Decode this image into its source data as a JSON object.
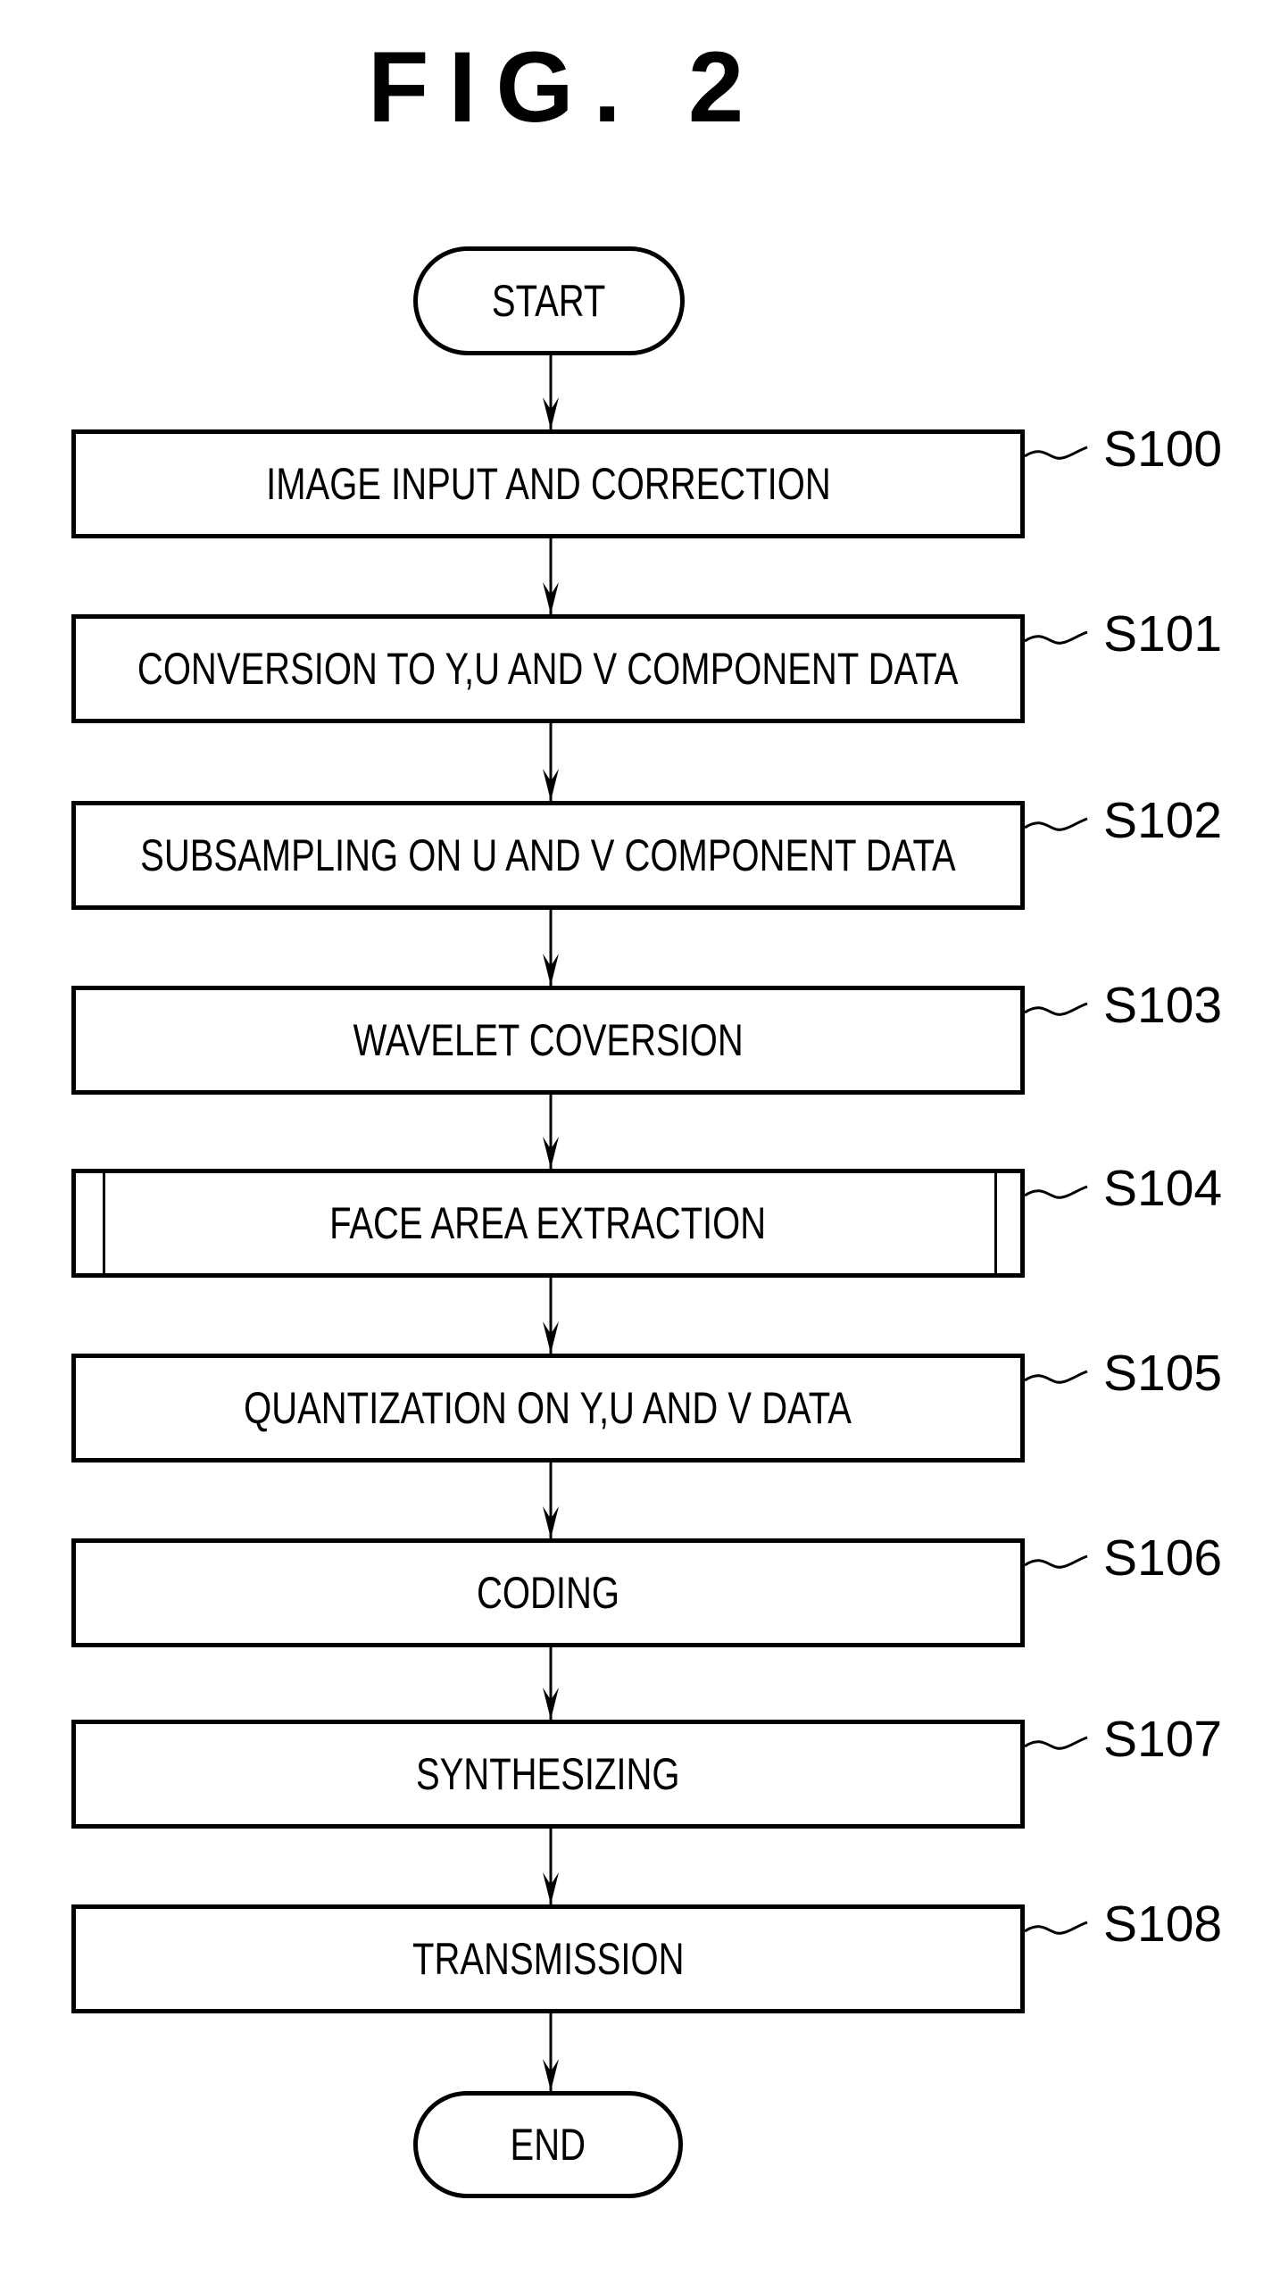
{
  "figure": {
    "title": "FIG. 2"
  },
  "flowchart": {
    "start_label": "START",
    "end_label": "END",
    "steps": [
      {
        "id": "S100",
        "text": "IMAGE INPUT AND CORRECTION",
        "type": "process"
      },
      {
        "id": "S101",
        "text": "CONVERSION TO Y,U AND V COMPONENT DATA",
        "type": "process"
      },
      {
        "id": "S102",
        "text": "SUBSAMPLING ON U AND V COMPONENT DATA",
        "type": "process"
      },
      {
        "id": "S103",
        "text": "WAVELET COVERSION",
        "type": "process"
      },
      {
        "id": "S104",
        "text": "FACE AREA EXTRACTION",
        "type": "subroutine"
      },
      {
        "id": "S105",
        "text": "QUANTIZATION ON Y,U AND V DATA",
        "type": "process"
      },
      {
        "id": "S106",
        "text": "CODING",
        "type": "process"
      },
      {
        "id": "S107",
        "text": "SYNTHESIZING",
        "type": "process"
      },
      {
        "id": "S108",
        "text": "TRANSMISSION",
        "type": "process"
      }
    ]
  }
}
